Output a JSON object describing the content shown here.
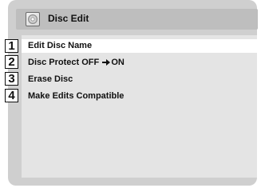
{
  "header": {
    "title": "Disc Edit",
    "icon": "disc-icon"
  },
  "menu": {
    "items": [
      {
        "number": "1",
        "label": "Edit Disc Name",
        "selected": true
      },
      {
        "number": "2",
        "label_before": "Disc Protect OFF",
        "label_after": "ON",
        "arrow_icon": "right-arrow-icon",
        "selected": false
      },
      {
        "number": "3",
        "label": "Erase Disc",
        "selected": false
      },
      {
        "number": "4",
        "label": "Make Edits Compatible",
        "selected": false
      }
    ]
  },
  "colors": {
    "frame": "#cfcfcf",
    "header_bar": "#bebebe",
    "content": "#e4e4e4",
    "highlight": "#ffffff",
    "text": "#111111"
  }
}
